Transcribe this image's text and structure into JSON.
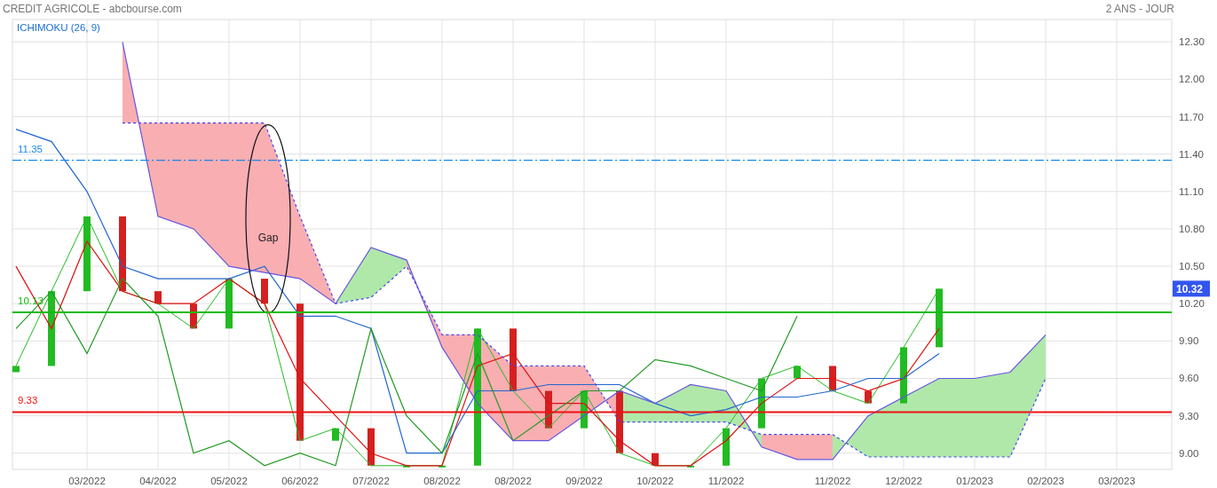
{
  "header": {
    "title": "CREDIT AGRICOLE - abcbourse.com",
    "period": "2 ANS - JOUR"
  },
  "chart_data": {
    "type": "line",
    "title": "ICHIMOKU (26, 9)",
    "categories": [
      null,
      null,
      "03/2022",
      null,
      "04/2022",
      null,
      "05/2022",
      null,
      "06/2022",
      null,
      "07/2022",
      null,
      "08/2022",
      null,
      "08/2022",
      null,
      "09/2022",
      null,
      "10/2022",
      null,
      "11/2022",
      null,
      null,
      "11/2022",
      null,
      "12/2022",
      null,
      "01/2023",
      null,
      "02/2023",
      null,
      "03/2023"
    ],
    "series": [
      {
        "color": "#22bb22",
        "values": [
          9.7,
          10.3,
          10.9,
          10.3,
          10.2,
          10.0,
          10.4,
          10.2,
          9.1,
          9.2,
          8.9,
          8.9,
          8.9,
          10.0,
          9.5,
          9.2,
          9.5,
          9.0,
          8.9,
          8.9,
          9.2,
          9.6,
          9.7,
          9.5,
          9.4,
          9.85,
          10.32,
          null,
          null,
          null,
          null,
          null
        ]
      },
      {
        "color": "#dd1111",
        "values": [
          10.5,
          10.0,
          10.7,
          10.3,
          10.2,
          10.2,
          10.4,
          10.2,
          9.6,
          9.3,
          9.0,
          8.9,
          8.9,
          9.7,
          9.8,
          9.4,
          9.4,
          9.1,
          8.9,
          8.9,
          9.1,
          9.4,
          9.6,
          9.6,
          9.5,
          9.6,
          10.0,
          null,
          null,
          null,
          null,
          null
        ]
      },
      {
        "color": "#2266cc",
        "values": [
          11.6,
          11.5,
          11.1,
          10.5,
          10.4,
          10.4,
          10.4,
          10.5,
          10.1,
          10.1,
          10.0,
          9.0,
          9.0,
          9.5,
          9.5,
          9.55,
          9.55,
          9.55,
          9.4,
          9.3,
          9.35,
          9.45,
          9.45,
          9.5,
          9.6,
          9.6,
          9.8,
          null,
          null,
          null,
          null,
          null
        ]
      },
      {
        "color": "#229922",
        "values": [
          10.0,
          10.3,
          9.8,
          10.4,
          10.1,
          9.0,
          9.1,
          8.9,
          9.0,
          8.9,
          10.0,
          9.3,
          9.0,
          9.8,
          9.1,
          9.3,
          9.5,
          9.5,
          9.75,
          9.7,
          9.6,
          9.5,
          10.1,
          null,
          null,
          null,
          null,
          null,
          null,
          null,
          null,
          null
        ]
      },
      {
        "color": "#6655dd",
        "values": [
          null,
          null,
          null,
          12.3,
          10.9,
          10.8,
          10.5,
          10.45,
          10.4,
          10.2,
          10.65,
          10.55,
          9.85,
          9.4,
          9.1,
          9.1,
          9.3,
          9.5,
          9.4,
          9.55,
          9.5,
          9.05,
          8.95,
          8.95,
          9.3,
          9.45,
          9.6,
          9.6,
          9.65,
          9.95,
          null,
          null
        ]
      },
      {
        "color": "#4444ee",
        "line_style": "dashed",
        "values": [
          null,
          null,
          null,
          11.65,
          11.65,
          11.65,
          11.65,
          11.65,
          10.9,
          10.2,
          10.25,
          10.5,
          9.95,
          9.95,
          9.7,
          9.7,
          9.7,
          9.25,
          9.25,
          9.25,
          9.25,
          9.15,
          9.15,
          9.15,
          8.97,
          8.97,
          8.97,
          8.97,
          8.97,
          9.6,
          null,
          null
        ]
      }
    ],
    "grid": true,
    "ylim": [
      8.87,
      12.48
    ],
    "yticks": [
      {
        "value": 12.3,
        "label": "12.30"
      },
      {
        "value": 12.0,
        "label": "12.00"
      },
      {
        "value": 11.7,
        "label": "11.70"
      },
      {
        "value": 11.4,
        "label": "11.40"
      },
      {
        "value": 11.1,
        "label": "11.10"
      },
      {
        "value": 10.8,
        "label": "10.80"
      },
      {
        "value": 10.5,
        "label": "10.50"
      },
      {
        "value": 10.2,
        "label": "10.20"
      },
      {
        "value": 9.9,
        "label": "9.90"
      },
      {
        "value": 9.6,
        "label": "9.60"
      },
      {
        "value": 9.3,
        "label": "9.30"
      },
      {
        "value": 9.0,
        "label": "9.00"
      }
    ],
    "annotations": [
      "Gap"
    ],
    "ref_lines": [
      {
        "axis": "y",
        "value": 11.35,
        "label": "11.35",
        "color": "#1a88e8",
        "line_style": "dashdot"
      },
      {
        "axis": "y",
        "value": 10.13,
        "label": "10.13",
        "color": "#11bb11",
        "line_style": "solid"
      },
      {
        "axis": "y",
        "value": 9.33,
        "label": "9.33",
        "color": "#ee1111",
        "line_style": "solid"
      }
    ]
  },
  "price_tag": "10.32"
}
